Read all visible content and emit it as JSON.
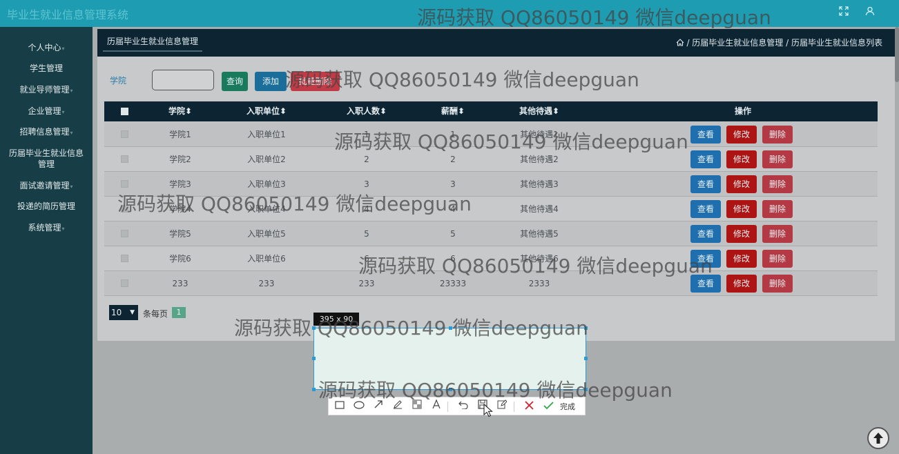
{
  "app": {
    "title": "毕业生就业信息管理系统"
  },
  "topbar": {
    "fullscreen_icon": "fullscreen-icon",
    "user_icon": "user-icon"
  },
  "sidebar": {
    "items": [
      {
        "label": "个人中心"
      },
      {
        "label": "学生管理"
      },
      {
        "label": "就业导师管理"
      },
      {
        "label": "企业管理"
      },
      {
        "label": "招聘信息管理"
      },
      {
        "label": "历届毕业生就业信息管理"
      },
      {
        "label": "面试邀请管理"
      },
      {
        "label": "投递的简历管理"
      },
      {
        "label": "系统管理"
      }
    ]
  },
  "panel": {
    "tab_label": "历届毕业生就业信息管理",
    "breadcrumb": "/ 历届毕业生就业信息管理 / 历届毕业生就业信息列表"
  },
  "search": {
    "label": "学院",
    "value": "",
    "query_label": "查询",
    "add_label": "添加",
    "batch_delete_label": "批量删除"
  },
  "table": {
    "headers": [
      "学院",
      "入职单位",
      "入职人数",
      "薪酬",
      "其他待遇",
      "操作"
    ],
    "rows": [
      [
        "学院1",
        "入职单位1",
        "1",
        "1",
        "其他待遇1"
      ],
      [
        "学院2",
        "入职单位2",
        "2",
        "2",
        "其他待遇2"
      ],
      [
        "学院3",
        "入职单位3",
        "3",
        "3",
        "其他待遇3"
      ],
      [
        "学院4",
        "入职单位4",
        "4",
        "4",
        "其他待遇4"
      ],
      [
        "学院5",
        "入职单位5",
        "5",
        "5",
        "其他待遇5"
      ],
      [
        "学院6",
        "入职单位6",
        "6",
        "6",
        "其他待遇6"
      ],
      [
        "233",
        "233",
        "233",
        "23333",
        "2333"
      ]
    ],
    "actions": {
      "view": "查看",
      "edit": "修改",
      "delete": "删除"
    }
  },
  "pagination": {
    "page_size": "10",
    "per_page_label": "条每页",
    "current_page": "1"
  },
  "capture": {
    "size_label": "395 x 90",
    "done_label": "完成"
  },
  "watermark": "源码获取 QQ86050149 微信deepguan"
}
